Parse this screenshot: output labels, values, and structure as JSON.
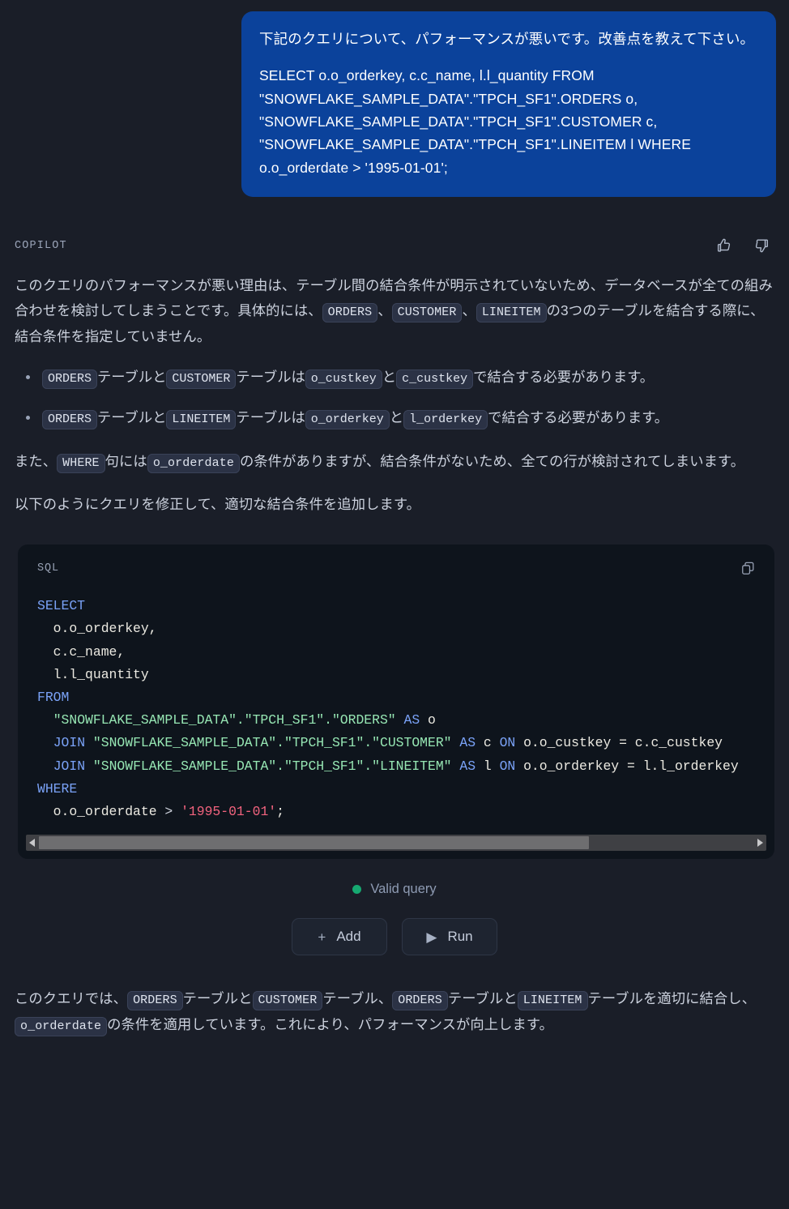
{
  "user_message": {
    "paragraphs": [
      "下記のクエリについて、パフォーマンスが悪いです。改善点を教えて下さい。",
      "SELECT o.o_orderkey, c.c_name, l.l_quantity FROM \"SNOWFLAKE_SAMPLE_DATA\".\"TPCH_SF1\".ORDERS o, \"SNOWFLAKE_SAMPLE_DATA\".\"TPCH_SF1\".CUSTOMER c, \"SNOWFLAKE_SAMPLE_DATA\".\"TPCH_SF1\".LINEITEM l WHERE o.o_orderdate > '1995-01-01';"
    ]
  },
  "assistant": {
    "label": "COPILOT",
    "thumbs_up_icon": "thumbs-up-icon",
    "thumbs_down_icon": "thumbs-down-icon",
    "intro": {
      "seg1": "このクエリのパフォーマンスが悪い理由は、テーブル間の結合条件が明示されていないため、データベースが全ての組み合わせを検討してしまうことです。具体的には、",
      "chip1": "ORDERS",
      "seg2": "、",
      "chip2": "CUSTOMER",
      "seg3": "、",
      "chip3": "LINEITEM",
      "seg4": "の3つのテーブルを結合する際に、結合条件を指定していません。"
    },
    "bullets": [
      {
        "chip1": "ORDERS",
        "seg1": "テーブルと",
        "chip2": "CUSTOMER",
        "seg2": "テーブルは",
        "chip3": "o_custkey",
        "seg3": "と",
        "chip4": "c_custkey",
        "seg4": "で結合する必要があります。"
      },
      {
        "chip1": "ORDERS",
        "seg1": "テーブルと",
        "chip2": "LINEITEM",
        "seg2": "テーブルは",
        "chip3": "o_orderkey",
        "seg3": "と",
        "chip4": "l_orderkey",
        "seg4": "で結合する必要があります。"
      }
    ],
    "note": {
      "seg1": "また、",
      "chip1": "WHERE",
      "seg2": "句には",
      "chip2": "o_orderdate",
      "seg3": "の条件がありますが、結合条件がないため、全ての行が検討されてしまいます。"
    },
    "lead_in": "以下のようにクエリを修正して、適切な結合条件を追加します。",
    "closing": {
      "seg1": "このクエリでは、",
      "chip1": "ORDERS",
      "seg2": "テーブルと",
      "chip2": "CUSTOMER",
      "seg3": "テーブル、",
      "chip3": "ORDERS",
      "seg4": "テーブルと",
      "chip4": "LINEITEM",
      "seg5": "テーブルを適切に結合し、",
      "chip5": "o_orderdate",
      "seg6": "の条件を適用しています。これにより、パフォーマンスが向上します。"
    }
  },
  "code_block": {
    "language": "SQL",
    "copy_icon": "copy-icon",
    "lines": [
      [
        {
          "t": "SELECT",
          "c": "k"
        }
      ],
      [
        {
          "t": "  o.o_orderkey,",
          "c": "id"
        }
      ],
      [
        {
          "t": "  c.c_name,",
          "c": "id"
        }
      ],
      [
        {
          "t": "  l.l_quantity",
          "c": "id"
        }
      ],
      [
        {
          "t": "FROM",
          "c": "k"
        }
      ],
      [
        {
          "t": "  ",
          "c": "id"
        },
        {
          "t": "\"SNOWFLAKE_SAMPLE_DATA\".\"TPCH_SF1\".\"ORDERS\"",
          "c": "s"
        },
        {
          "t": " ",
          "c": "id"
        },
        {
          "t": "AS",
          "c": "k"
        },
        {
          "t": " o",
          "c": "id"
        }
      ],
      [
        {
          "t": "  ",
          "c": "id"
        },
        {
          "t": "JOIN",
          "c": "k"
        },
        {
          "t": " ",
          "c": "id"
        },
        {
          "t": "\"SNOWFLAKE_SAMPLE_DATA\".\"TPCH_SF1\".\"CUSTOMER\"",
          "c": "s"
        },
        {
          "t": " ",
          "c": "id"
        },
        {
          "t": "AS",
          "c": "k"
        },
        {
          "t": " c ",
          "c": "id"
        },
        {
          "t": "ON",
          "c": "k"
        },
        {
          "t": " o.o_custkey = c.c_custkey",
          "c": "id"
        }
      ],
      [
        {
          "t": "  ",
          "c": "id"
        },
        {
          "t": "JOIN",
          "c": "k"
        },
        {
          "t": " ",
          "c": "id"
        },
        {
          "t": "\"SNOWFLAKE_SAMPLE_DATA\".\"TPCH_SF1\".\"LINEITEM\"",
          "c": "s"
        },
        {
          "t": " ",
          "c": "id"
        },
        {
          "t": "AS",
          "c": "k"
        },
        {
          "t": " l ",
          "c": "id"
        },
        {
          "t": "ON",
          "c": "k"
        },
        {
          "t": " o.o_orderkey = l.l_orderkey",
          "c": "id"
        }
      ],
      [
        {
          "t": "WHERE",
          "c": "k"
        }
      ],
      [
        {
          "t": "  o.o_orderdate ",
          "c": "id"
        },
        {
          "t": ">",
          "c": "op"
        },
        {
          "t": " ",
          "c": "id"
        },
        {
          "t": "'1995-01-01'",
          "c": "lit"
        },
        {
          "t": ";",
          "c": "id"
        }
      ]
    ],
    "scrollbar": {
      "thumb_percent": 77,
      "left_arrow_icon": "chevron-left-icon",
      "right_arrow_icon": "chevron-right-icon"
    }
  },
  "status": {
    "text": "Valid query",
    "dot_color": "#16a971"
  },
  "actions": [
    {
      "label": "Add",
      "glyph": "+",
      "icon_name": "plus-icon"
    },
    {
      "label": "Run",
      "glyph": "▶",
      "icon_name": "play-icon"
    }
  ]
}
